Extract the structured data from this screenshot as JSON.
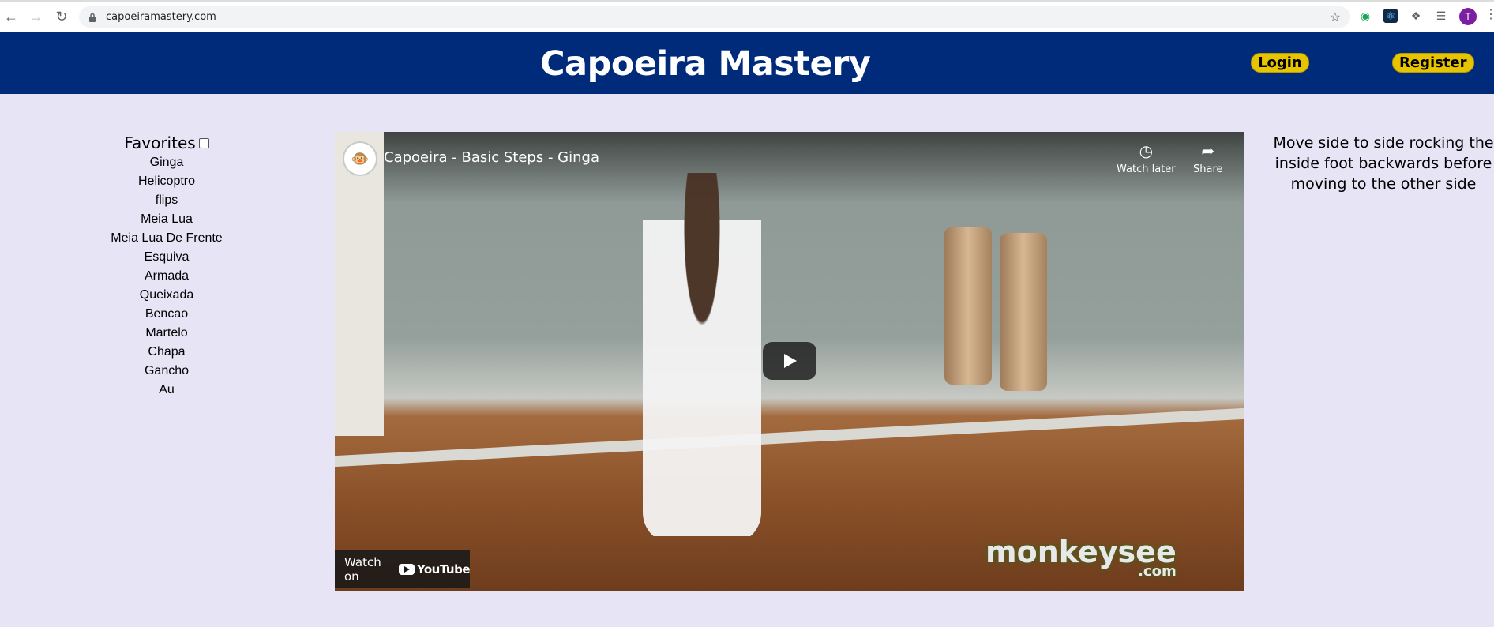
{
  "browser": {
    "url": "capoeiramastery.com",
    "avatar_letter": "T",
    "icons": [
      "back-arrow-icon",
      "forward-arrow-icon",
      "reload-icon",
      "lock-icon",
      "star-icon",
      "extension-puzzle-icon",
      "media-icon",
      "menu-kebab-icon"
    ]
  },
  "header": {
    "title": "Capoeira Mastery",
    "login_label": "Login",
    "register_label": "Register",
    "colors": {
      "background": "#002a7a",
      "button": "#e7c400"
    }
  },
  "sidebar": {
    "favorites_label": "Favorites",
    "moves": [
      "Ginga",
      "Helicoptro",
      "flips",
      "Meia Lua",
      "Meia Lua De Frente",
      "Esquiva",
      "Armada",
      "Queixada",
      "Bencao",
      "Martelo",
      "Chapa",
      "Gancho",
      "Au"
    ]
  },
  "video": {
    "title": "Capoeira - Basic Steps - Ginga",
    "watch_later_label": "Watch later",
    "share_label": "Share",
    "watch_on_label": "Watch on",
    "youtube_label": "YouTube",
    "watermark": "monkeysee",
    "watermark_suffix": ".com"
  },
  "description": {
    "text": "Move side to side rocking the inside foot backwards before moving to the other side"
  }
}
